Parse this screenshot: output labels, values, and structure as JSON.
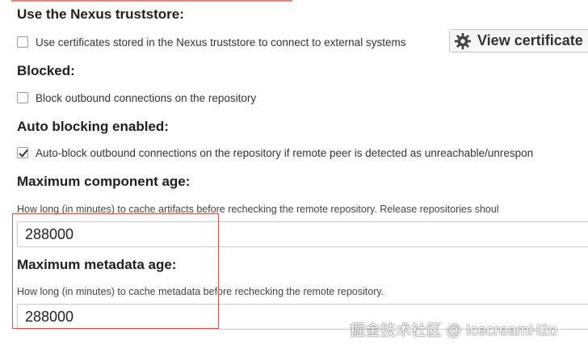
{
  "truststore": {
    "heading": "Use the Nexus truststore:",
    "checkbox_label": "Use certificates stored in the Nexus truststore to connect to external systems",
    "checked": false,
    "view_button_label": "View certificate"
  },
  "blocked": {
    "heading": "Blocked:",
    "checkbox_label": "Block outbound connections on the repository",
    "checked": false
  },
  "auto_blocking": {
    "heading": "Auto blocking enabled:",
    "checkbox_label": "Auto-block outbound connections on the repository if remote peer is detected as unreachable/unrespon",
    "checked": true
  },
  "max_component_age": {
    "heading": "Maximum component age:",
    "help": "How long (in minutes) to cache artifacts before rechecking the remote repository. Release repositories shoul",
    "value": "288000"
  },
  "max_metadata_age": {
    "heading": "Maximum metadata age:",
    "help": "How long (in minutes) to cache metadata before rechecking the remote repository.",
    "value": "288000"
  },
  "watermark": "掘金技术社区 @ IcecreamH2o",
  "colors": {
    "highlight_border": "#d9534f",
    "top_rule": "#e8837a"
  },
  "icons": {
    "view_button": "gear-icon",
    "checkbox_checked": "checkmark-icon"
  }
}
